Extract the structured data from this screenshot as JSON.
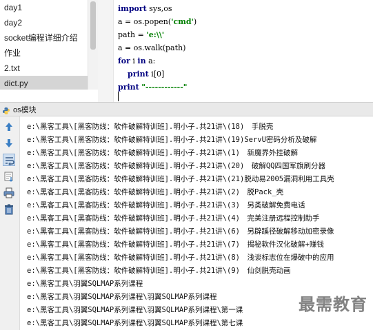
{
  "project_tree": {
    "items": [
      {
        "label": "day1",
        "selected": false
      },
      {
        "label": "day2",
        "selected": false
      },
      {
        "label": "socket编程详细介绍",
        "selected": false
      },
      {
        "label": "作业",
        "selected": false
      },
      {
        "label": "2.txt",
        "selected": false
      },
      {
        "label": "dict.py",
        "selected": true
      }
    ]
  },
  "editor": {
    "lines": [
      {
        "segments": [
          {
            "t": "import",
            "c": "kw"
          },
          {
            "t": " sys,os",
            "c": ""
          }
        ]
      },
      {
        "segments": [
          {
            "t": "a = os.popen(",
            "c": ""
          },
          {
            "t": "'cmd'",
            "c": "str"
          },
          {
            "t": ")",
            "c": ""
          }
        ]
      },
      {
        "segments": [
          {
            "t": "path = ",
            "c": ""
          },
          {
            "t": "'e:\\\\'",
            "c": "str"
          }
        ]
      },
      {
        "segments": [
          {
            "t": "a = os.walk(path)",
            "c": ""
          }
        ]
      },
      {
        "segments": [
          {
            "t": "for",
            "c": "kw"
          },
          {
            "t": " i ",
            "c": ""
          },
          {
            "t": "in",
            "c": "kw"
          },
          {
            "t": " a:",
            "c": ""
          }
        ]
      },
      {
        "segments": [
          {
            "t": "    ",
            "c": ""
          },
          {
            "t": "print",
            "c": "kw"
          },
          {
            "t": " i[0]",
            "c": ""
          }
        ]
      },
      {
        "segments": [
          {
            "t": "print",
            "c": "kw"
          },
          {
            "t": " ",
            "c": ""
          },
          {
            "t": "\"------------\"",
            "c": "str"
          }
        ]
      }
    ]
  },
  "run_panel": {
    "title": "os模块",
    "toolbar_icons": [
      "arrow-up-icon",
      "arrow-down-icon",
      "soft-wrap-icon",
      "scroll-to-end-icon",
      "print-icon",
      "trash-icon"
    ],
    "output_lines": [
      "e:\\黑客工具\\[黑客防线：软件破解特训班].明小子.共21讲\\(18)　手脱壳",
      "e:\\黑客工具\\[黑客防线：软件破解特训班].明小子.共21讲\\(19)ServU密码分析及破解",
      "e:\\黑客工具\\[黑客防线：软件破解特训班].明小子.共21讲\\(1)　新魔界外挂破解",
      "e:\\黑客工具\\[黑客防线：软件破解特训班].明小子.共21讲\\(20)　破解QQ四国军旗刷分器",
      "e:\\黑客工具\\[黑客防线：软件破解特训班].明小子.共21讲\\(21)脱动易2005漏洞利用工具壳",
      "e:\\黑客工具\\[黑客防线：软件破解特训班].明小子.共21讲\\(2)　脱Pack_壳",
      "e:\\黑客工具\\[黑客防线：软件破解特训班].明小子.共21讲\\(3)　另类破解免费电话",
      "e:\\黑客工具\\[黑客防线：软件破解特训班].明小子.共21讲\\(4)　完美注册远程控制助手",
      "e:\\黑客工具\\[黑客防线：软件破解特训班].明小子.共21讲\\(6)　另辟蹊径破解移动加密录像",
      "e:\\黑客工具\\[黑客防线：软件破解特训班].明小子.共21讲\\(7)　揭秘软件汉化破解+赚钱",
      "e:\\黑客工具\\[黑客防线：软件破解特训班].明小子.共21讲\\(8)　浅谈标志位在爆破中的应用",
      "e:\\黑客工具\\[黑客防线：软件破解特训班].明小子.共21讲\\(9)　仙剑脱壳动画",
      "e:\\黑客工具\\羽翼SQLMAP系列课程",
      "e:\\黑客工具\\羽翼SQLMAP系列课程\\羽翼SQLMAP系列课程",
      "e:\\黑客工具\\羽翼SQLMAP系列课程\\羽翼SQLMAP系列课程\\第一课",
      "e:\\黑客工具\\羽翼SQLMAP系列课程\\羽翼SQLMAP系列课程\\第七课"
    ],
    "watermark": "最需教育"
  },
  "colors": {
    "keyword": "#000080",
    "string": "#008000",
    "selection": "#d5d5d5"
  }
}
